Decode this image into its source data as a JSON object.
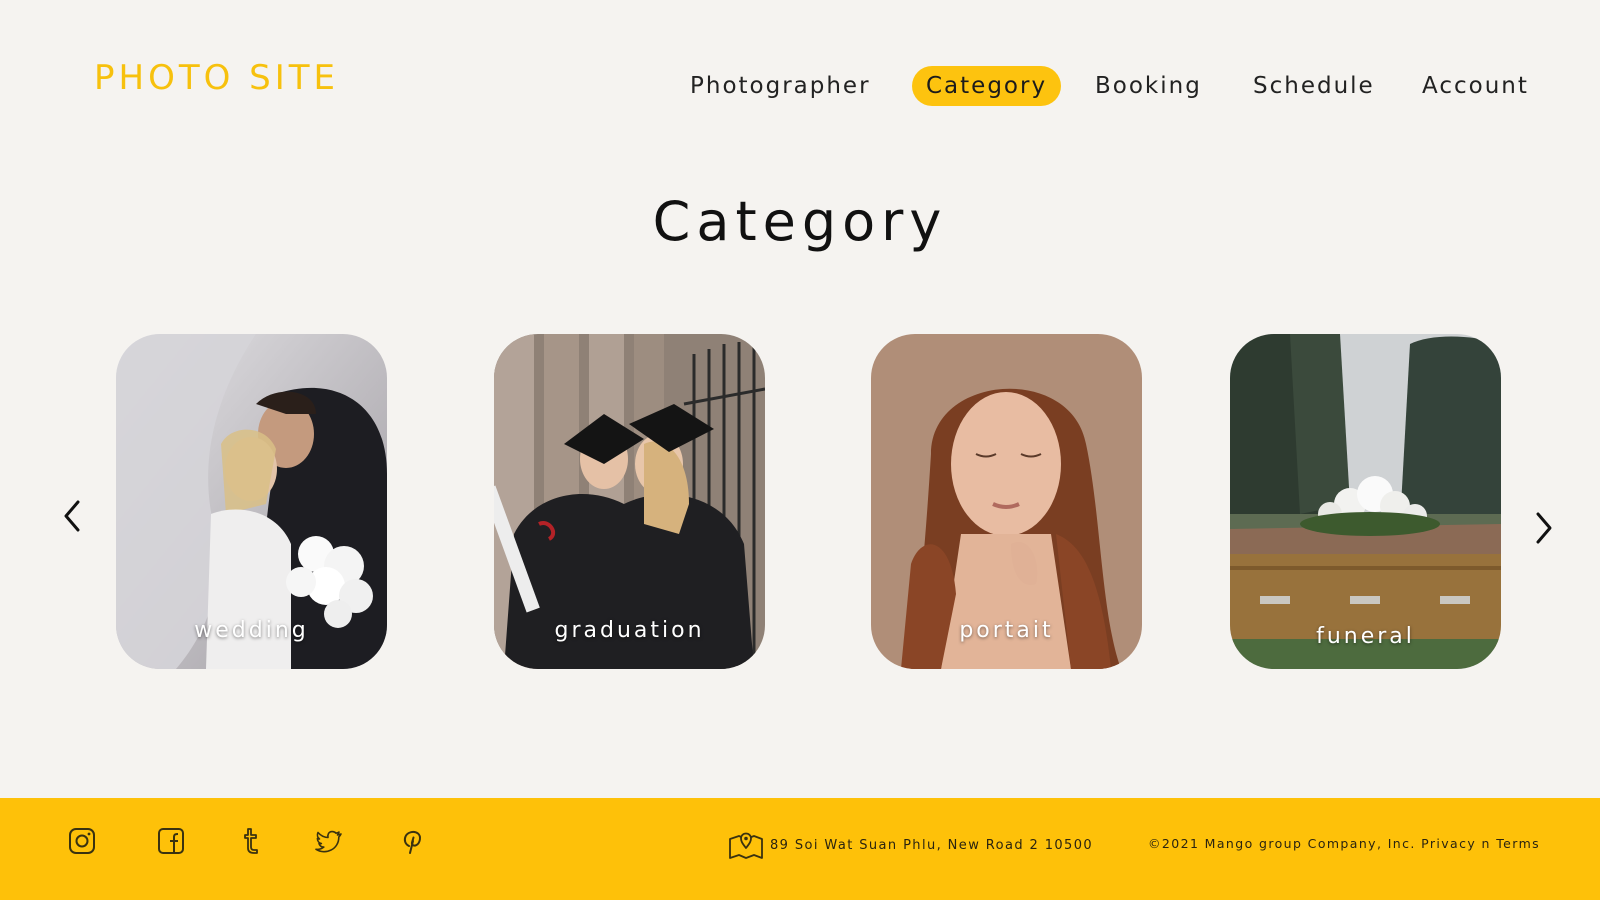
{
  "header": {
    "logo": "PHOTO SITE",
    "nav": [
      {
        "label": "Photographer",
        "active": false
      },
      {
        "label": "Category",
        "active": true
      },
      {
        "label": "Booking",
        "active": false
      },
      {
        "label": "Schedule",
        "active": false
      },
      {
        "label": "Account",
        "active": false
      }
    ]
  },
  "main": {
    "title": "Category",
    "carousel": {
      "prev_icon": "chevron-left-icon",
      "next_icon": "chevron-right-icon",
      "cards": [
        {
          "label": "wedding"
        },
        {
          "label": "graduation"
        },
        {
          "label": "portait"
        },
        {
          "label": "funeral"
        }
      ]
    }
  },
  "footer": {
    "social": [
      {
        "icon": "instagram-icon"
      },
      {
        "icon": "facebook-icon"
      },
      {
        "icon": "tumblr-icon"
      },
      {
        "icon": "twitter-icon"
      },
      {
        "icon": "pinterest-icon"
      }
    ],
    "address_icon": "map-pin-icon",
    "address": "89 Soi Wat Suan Phlu, New Road 2 10500",
    "copyright": "©2021 Mango group Company, Inc. Privacy n Terms"
  },
  "colors": {
    "accent": "#fec109",
    "background": "#f5f3f0",
    "logo": "#f7c10d"
  }
}
